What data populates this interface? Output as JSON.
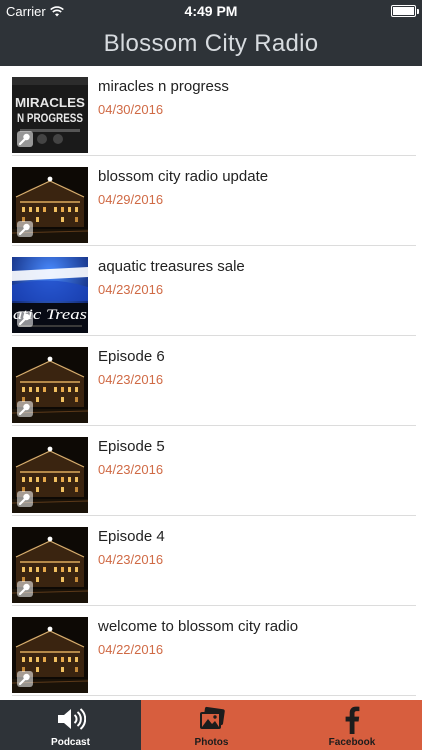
{
  "status": {
    "carrier": "Carrier",
    "time": "4:49 PM",
    "battery_level": 1.0
  },
  "nav": {
    "title": "Blossom City Radio"
  },
  "episodes": [
    {
      "title": "miracles n progress",
      "date": "04/30/2016",
      "art": "miracles-n-progress-art",
      "art_text": [
        "MIRACLES",
        "N PROGRESS"
      ]
    },
    {
      "title": "blossom city radio update",
      "date": "04/29/2016",
      "art": "night-building-art"
    },
    {
      "title": "aquatic treasures sale",
      "date": "04/23/2016",
      "art": "aquatic-treasures-art",
      "art_text": [
        "atic Treas"
      ]
    },
    {
      "title": "Episode 6",
      "date": "04/23/2016",
      "art": "night-building-art"
    },
    {
      "title": "Episode 5",
      "date": "04/23/2016",
      "art": "night-building-art"
    },
    {
      "title": "Episode 4",
      "date": "04/23/2016",
      "art": "night-building-art"
    },
    {
      "title": "welcome to blossom city radio",
      "date": "04/22/2016",
      "art": "night-building-art"
    }
  ],
  "tabs": [
    {
      "label": "Podcast",
      "icon": "speaker-icon",
      "active": true
    },
    {
      "label": "Photos",
      "icon": "photos-icon",
      "active": false
    },
    {
      "label": "Facebook",
      "icon": "facebook-icon",
      "active": false
    }
  ],
  "colors": {
    "bar": "#2e3338",
    "accent": "#d75e3e",
    "date": "#d06a45"
  }
}
